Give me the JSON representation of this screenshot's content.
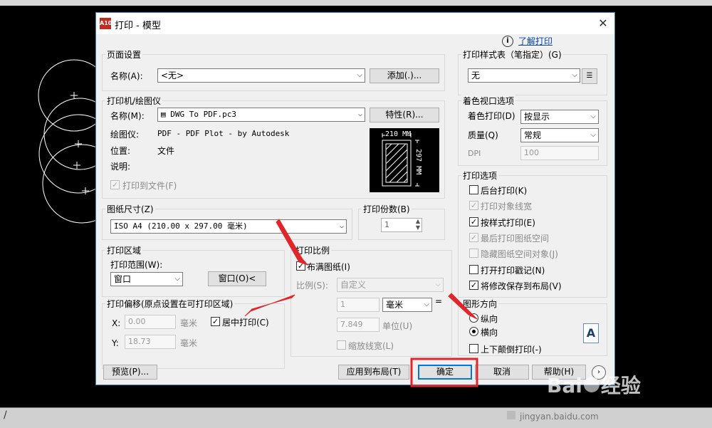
{
  "dialog": {
    "title": "打印 - 模型",
    "close_glyph": "✕",
    "app_icon_label": "A10",
    "learn_link": "了解打印",
    "page_setup": {
      "group": "页面设置",
      "name_label": "名称(A):",
      "name_value": "<无>",
      "add_btn": "添加(.)..."
    },
    "printer": {
      "group": "打印机/绘图仪",
      "name_label": "名称(M):",
      "name_value": "DWG To PDF.pc3",
      "prop_btn": "特性(R)...",
      "plotter_label": "绘图仪:",
      "plotter_value": "PDF - PDF Plot - by Autodesk",
      "location_label": "位置:",
      "location_value": "文件",
      "desc_label": "说明:",
      "print_to_file": "打印到文件(F)",
      "preview_width": "210 MM",
      "preview_height": "297 MM"
    },
    "paper": {
      "group": "图纸尺寸(Z)",
      "value": "ISO A4 (210.00 x 297.00 毫米)"
    },
    "copies": {
      "group": "打印份数(B)",
      "value": "1"
    },
    "area": {
      "group": "打印区域",
      "range_label": "打印范围(W):",
      "range_value": "窗口",
      "window_btn": "窗口(O)<"
    },
    "offset": {
      "group": "打印偏移(原点设置在可打印区域)",
      "x_label": "X:",
      "x_value": "0.00",
      "x_unit": "毫米",
      "y_label": "Y:",
      "y_value": "18.73",
      "y_unit": "毫米",
      "center_label": "居中打印(C)"
    },
    "scale": {
      "group": "打印比例",
      "fit_label": "布满图纸(I)",
      "scale_label": "比例(S):",
      "scale_value": "自定义",
      "v1": "1",
      "unit_value": "毫米",
      "eq": "=",
      "v2": "7.849",
      "unit_label": "单位(U)",
      "lineweight": "缩放线宽(L)"
    },
    "style_table": {
      "group": "打印样式表（笔指定）(G)",
      "value": "无"
    },
    "shaded": {
      "group": "着色视口选项",
      "shade_label": "着色打印(D)",
      "shade_value": "按显示",
      "quality_label": "质量(Q)",
      "quality_value": "常规",
      "dpi_label": "DPI",
      "dpi_value": "100"
    },
    "options": {
      "group": "打印选项",
      "items": [
        {
          "label": "后台打印(K)"
        },
        {
          "label": "打印对象线宽"
        },
        {
          "label": "按样式打印(E)"
        },
        {
          "label": "最后打印图纸空间"
        },
        {
          "label": "隐藏图纸空间对象(J)"
        },
        {
          "label": "打开打印戳记(N)"
        },
        {
          "label": "将修改保存到布局(V)"
        }
      ]
    },
    "orientation": {
      "group": "图形方向",
      "portrait": "纵向",
      "landscape": "横向",
      "upside": "上下颠倒打印(-)",
      "icon_letter": "A"
    },
    "buttons": {
      "preview": "预览(P)...",
      "apply": "应用到布局(T)",
      "ok": "确定",
      "cancel": "取消",
      "help": "帮助(H)"
    }
  },
  "watermark": {
    "brand": "Bai",
    "brand2": "经验",
    "url": "jingyan.baidu.com"
  },
  "colors": {
    "highlight": "#e0262b",
    "accent": "#3c7fb1"
  }
}
